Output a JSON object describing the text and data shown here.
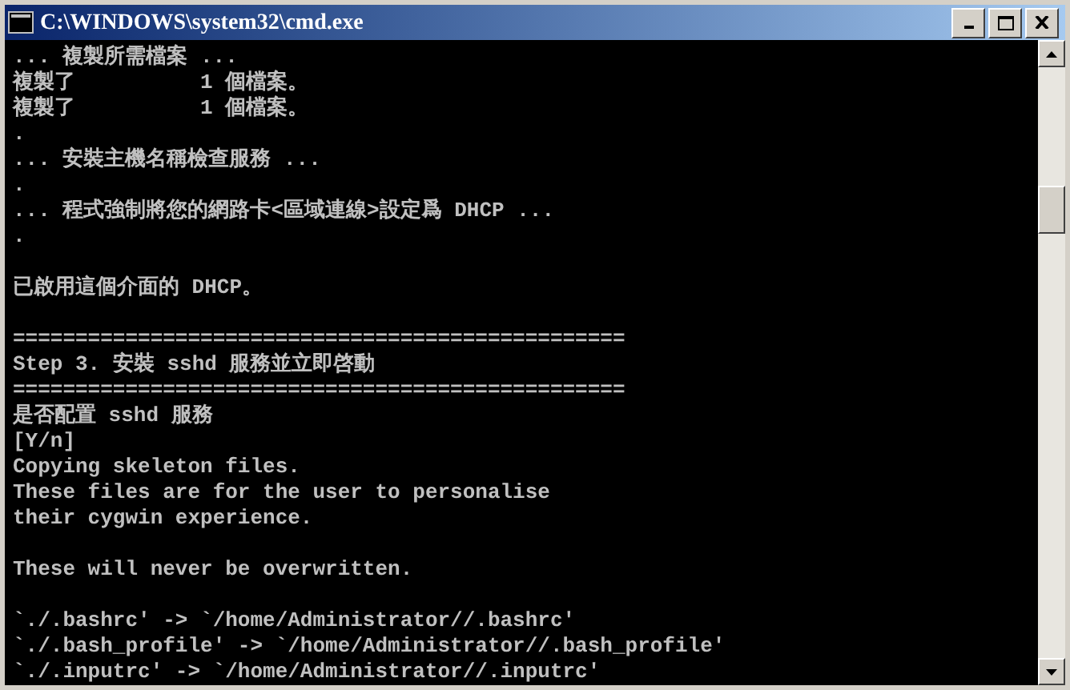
{
  "window": {
    "title": "C:\\WINDOWS\\system32\\cmd.exe"
  },
  "console": {
    "lines": [
      {
        "kind": "text",
        "text": "... 複製所需檔案 ..."
      },
      {
        "kind": "text",
        "text": "複製了          1 個檔案。"
      },
      {
        "kind": "text",
        "text": "複製了          1 個檔案。"
      },
      {
        "kind": "text",
        "text": "."
      },
      {
        "kind": "text",
        "text": "... 安裝主機名稱檢查服務 ..."
      },
      {
        "kind": "text",
        "text": "."
      },
      {
        "kind": "text",
        "text": "... 程式強制將您的網路卡<區域連線>設定爲 DHCP ..."
      },
      {
        "kind": "text",
        "text": "."
      },
      {
        "kind": "blank"
      },
      {
        "kind": "text",
        "text": "已啟用這個介面的 DHCP。"
      },
      {
        "kind": "blank"
      },
      {
        "kind": "text",
        "text": "================================================="
      },
      {
        "kind": "text",
        "text": "Step 3. 安裝 sshd 服務並立即啓動"
      },
      {
        "kind": "text",
        "text": "================================================="
      },
      {
        "kind": "text",
        "text": "是否配置 sshd 服務"
      },
      {
        "kind": "text",
        "text": "[Y/n]"
      },
      {
        "kind": "text",
        "text": "Copying skeleton files."
      },
      {
        "kind": "text",
        "text": "These files are for the user to personalise"
      },
      {
        "kind": "text",
        "text": "their cygwin experience."
      },
      {
        "kind": "blank"
      },
      {
        "kind": "text",
        "text": "These will never be overwritten."
      },
      {
        "kind": "blank"
      },
      {
        "kind": "text",
        "text": "`./.bashrc' -> `/home/Administrator//.bashrc'"
      },
      {
        "kind": "text",
        "text": "`./.bash_profile' -> `/home/Administrator//.bash_profile'"
      },
      {
        "kind": "text",
        "text": "`./.inputrc' -> `/home/Administrator//.inputrc'"
      }
    ]
  }
}
